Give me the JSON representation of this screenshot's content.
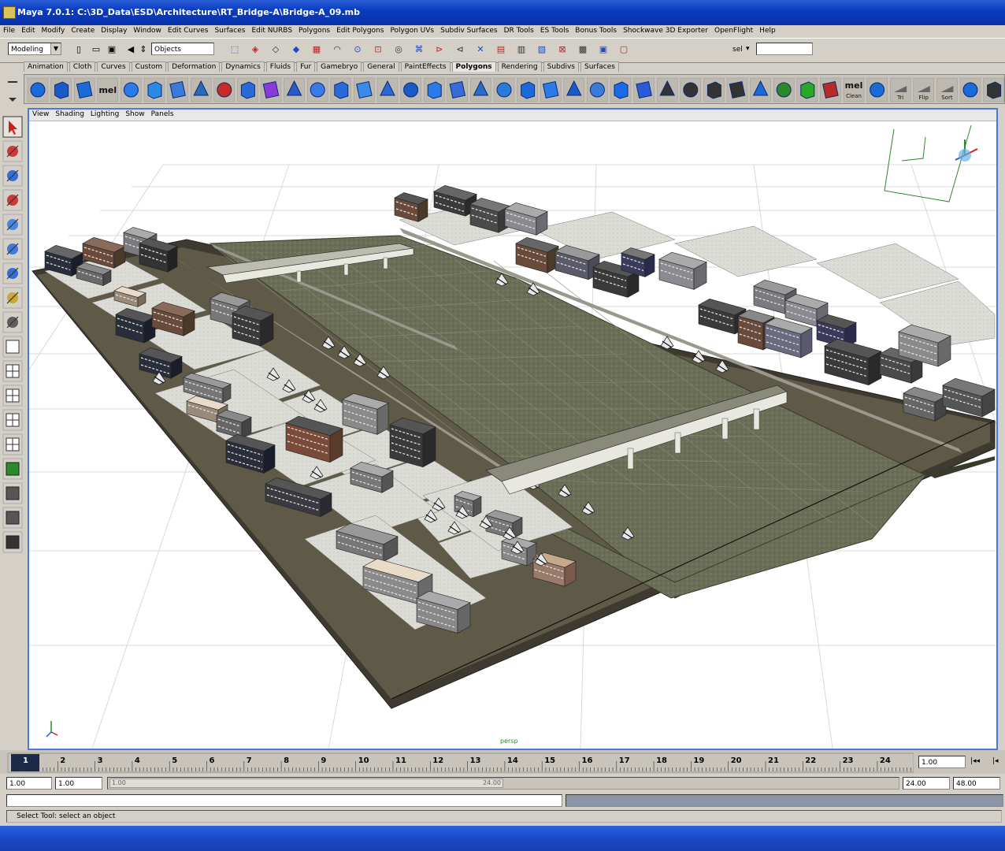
{
  "window": {
    "title": "Maya 7.0.1: C:\\3D_Data\\ESD\\Architecture\\RT_Bridge-A\\Bridge-A_09.mb"
  },
  "menu": [
    "File",
    "Edit",
    "Modify",
    "Create",
    "Display",
    "Window",
    "Edit Curves",
    "Surfaces",
    "Edit NURBS",
    "Polygons",
    "Edit Polygons",
    "Polygon UVs",
    "Subdiv Surfaces",
    "DR Tools",
    "ES Tools",
    "Bonus Tools",
    "Shockwave 3D Exporter",
    "OpenFlight",
    "Help"
  ],
  "status_line": {
    "mode": "Modeling",
    "selection_mode": "Objects",
    "field_label": "sel",
    "input_value": ""
  },
  "shelf_tabs": [
    "Animation",
    "Cloth",
    "Curves",
    "Custom",
    "Deformation",
    "Dynamics",
    "Fluids",
    "Fur",
    "Gamebryo",
    "General",
    "PaintEffects",
    "Polygons",
    "Rendering",
    "Subdivs",
    "Surfaces"
  ],
  "active_shelf_tab": "Polygons",
  "shelf_text_icons": {
    "mel": "mel",
    "mel_clean": "Clean",
    "tri": "Tri",
    "flip": "Flip",
    "sort": "Sort"
  },
  "viewport": {
    "menu": [
      "View",
      "Shading",
      "Lighting",
      "Show",
      "Panels"
    ],
    "camera_label": "persp"
  },
  "timeline": {
    "ticks": [
      "1",
      "2",
      "3",
      "4",
      "5",
      "6",
      "7",
      "8",
      "9",
      "10",
      "11",
      "12",
      "13",
      "14",
      "15",
      "16",
      "17",
      "18",
      "19",
      "20",
      "21",
      "22",
      "23",
      "24"
    ],
    "current_frame": "1.00"
  },
  "range": {
    "start_time": "1.00",
    "playback_start": "1.00",
    "slider_left": "1.00",
    "slider_right": "24.00",
    "playback_end": "24.00",
    "end_time": "48.00"
  },
  "help_line": "Select Tool: select an object",
  "colors": {
    "title_blue": "#0a3cc0",
    "viewport_border": "#4a7ad8",
    "accent_blue": "#1a5ad8"
  }
}
